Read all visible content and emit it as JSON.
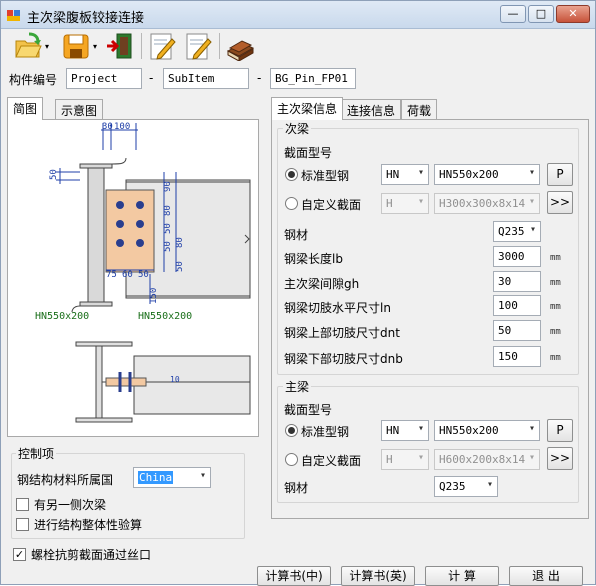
{
  "window": {
    "title": "主次梁腹板铰接连接",
    "min": "—",
    "max": "□",
    "close": "✕"
  },
  "toolbar": {
    "open": "open-icon",
    "save": "save-icon",
    "exit": "exit-icon",
    "edit1": "edit-icon",
    "edit2": "edit-alt-icon",
    "help": "book-icon"
  },
  "member": {
    "label": "构件编号",
    "project": "Project",
    "dash1": "-",
    "subitem": "SubItem",
    "dash2": "-",
    "id": "BG_Pin_FP01"
  },
  "left_tabs": {
    "tab1": "简图",
    "tab2": "示意图"
  },
  "drawing": {
    "dim_30": "30",
    "dim_100": "100",
    "dim_50_left": "50",
    "dim_90": "90",
    "dim_80a": "80",
    "dim_50a": "50",
    "dim_50b": "50",
    "dim_80b": "80",
    "dim_50c": "50",
    "dim_150": "150",
    "dim_75": "75",
    "dim_60": "60",
    "dim_50bot": "50",
    "main_section": "HN550x200",
    "sub_section": "HN550x200",
    "side_dim": "10"
  },
  "control": {
    "title": "控制项",
    "country_label": "钢结构材料所属国",
    "country_value": "China",
    "chk_other": "有另一侧次梁",
    "chk_check": "进行结构整体性验算"
  },
  "bolt_chk": {
    "label": "螺栓抗剪截面通过丝口",
    "checked": "✓"
  },
  "right_tabs": {
    "tab1": "主次梁信息",
    "tab2": "连接信息",
    "tab3": "荷载"
  },
  "secondary": {
    "title": "次梁",
    "section_label": "截面型号",
    "std_label": "标准型钢",
    "std_type": "HN",
    "std_size": "HN550x200",
    "p_btn": "P",
    "custom_label": "自定义截面",
    "custom_type": "H",
    "custom_size": "H300x300x8x14",
    "more_btn": ">>",
    "steel_label": "钢材",
    "steel_value": "Q235",
    "length_label": "钢梁长度lb",
    "length_value": "3000",
    "gap_label": "主次梁间隙gh",
    "gap_value": "30",
    "cut_h_label": "钢梁切肢水平尺寸ln",
    "cut_h_value": "100",
    "cut_top_label": "钢梁上部切肢尺寸dnt",
    "cut_top_value": "50",
    "cut_bot_label": "钢梁下部切肢尺寸dnb",
    "cut_bot_value": "150",
    "unit": "mm"
  },
  "main_beam": {
    "title": "主梁",
    "section_label": "截面型号",
    "std_label": "标准型钢",
    "std_type": "HN",
    "std_size": "HN550x200",
    "p_btn": "P",
    "custom_label": "自定义截面",
    "custom_type": "H",
    "custom_size": "H600x200x8x14",
    "more_btn": ">>",
    "steel_label": "钢材",
    "steel_value": "Q235"
  },
  "bottom": {
    "report_cn": "计算书(中)",
    "report_en": "计算书(英)",
    "calc": "计  算",
    "exit": "退  出"
  },
  "arrow": "▾"
}
